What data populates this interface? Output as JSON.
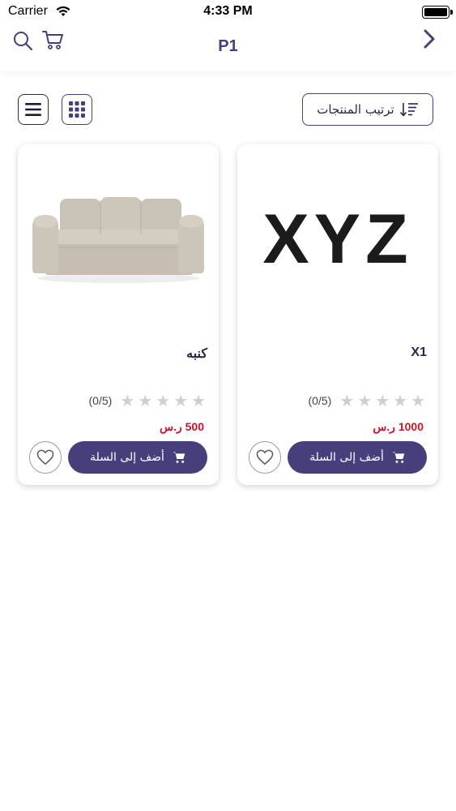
{
  "status_bar": {
    "carrier": "Carrier",
    "time": "4:33 PM"
  },
  "header": {
    "title": "P1"
  },
  "toolbar": {
    "sort_label": "ترتيب المنتجات"
  },
  "products": [
    {
      "name": "X1",
      "logo_text": "XYZ",
      "rating_count": "(0/5)",
      "rating": 0,
      "price": "1000 ر.س",
      "add_to_cart_label": "أضف إلى السلة"
    },
    {
      "name": "كنبه",
      "rating_count": "(0/5)",
      "rating": 0,
      "price": "500 ر.س",
      "add_to_cart_label": "أضف إلى السلة"
    }
  ],
  "colors": {
    "primary": "#463f7c",
    "price": "#c2162c",
    "star_empty": "#cfcfcf"
  }
}
